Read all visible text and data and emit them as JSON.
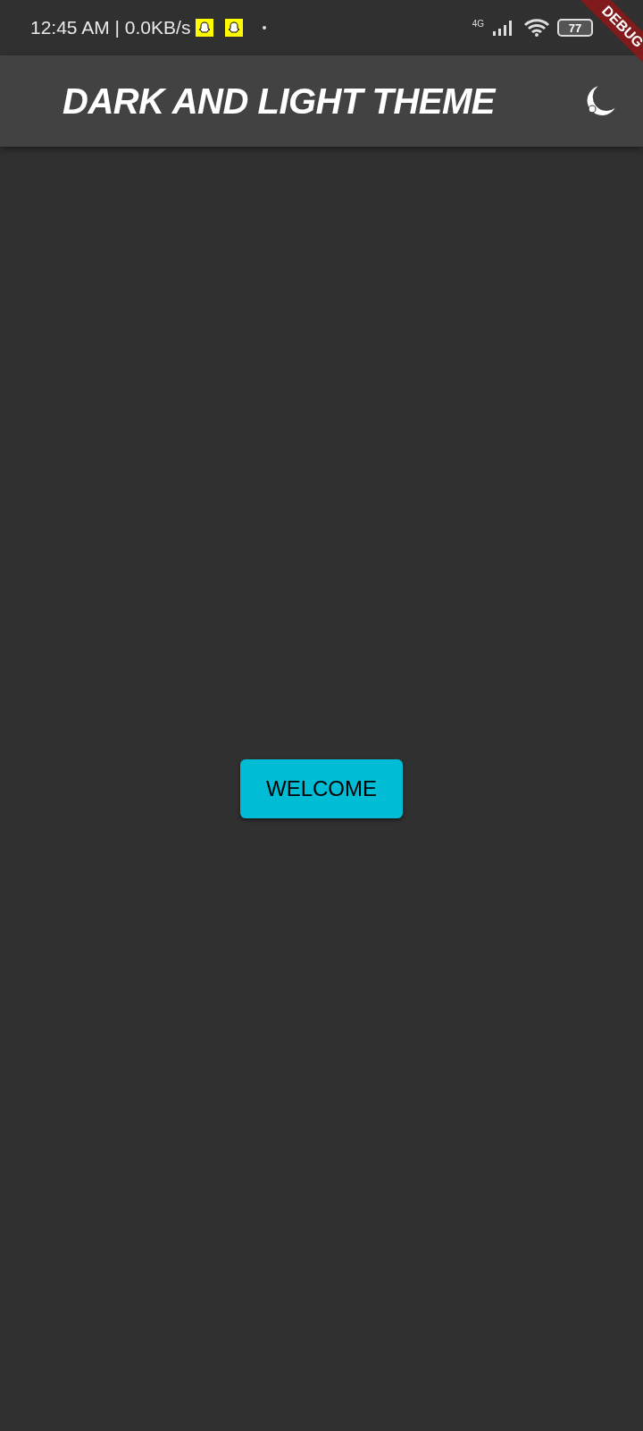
{
  "status_bar": {
    "time_speed": "12:45 AM | 0.0KB/s",
    "network": "4G",
    "battery": "77"
  },
  "app_bar": {
    "title": "DARK AND LIGHT THEME"
  },
  "debug_banner": "DEBUG",
  "button": {
    "label": "WELCOME"
  }
}
